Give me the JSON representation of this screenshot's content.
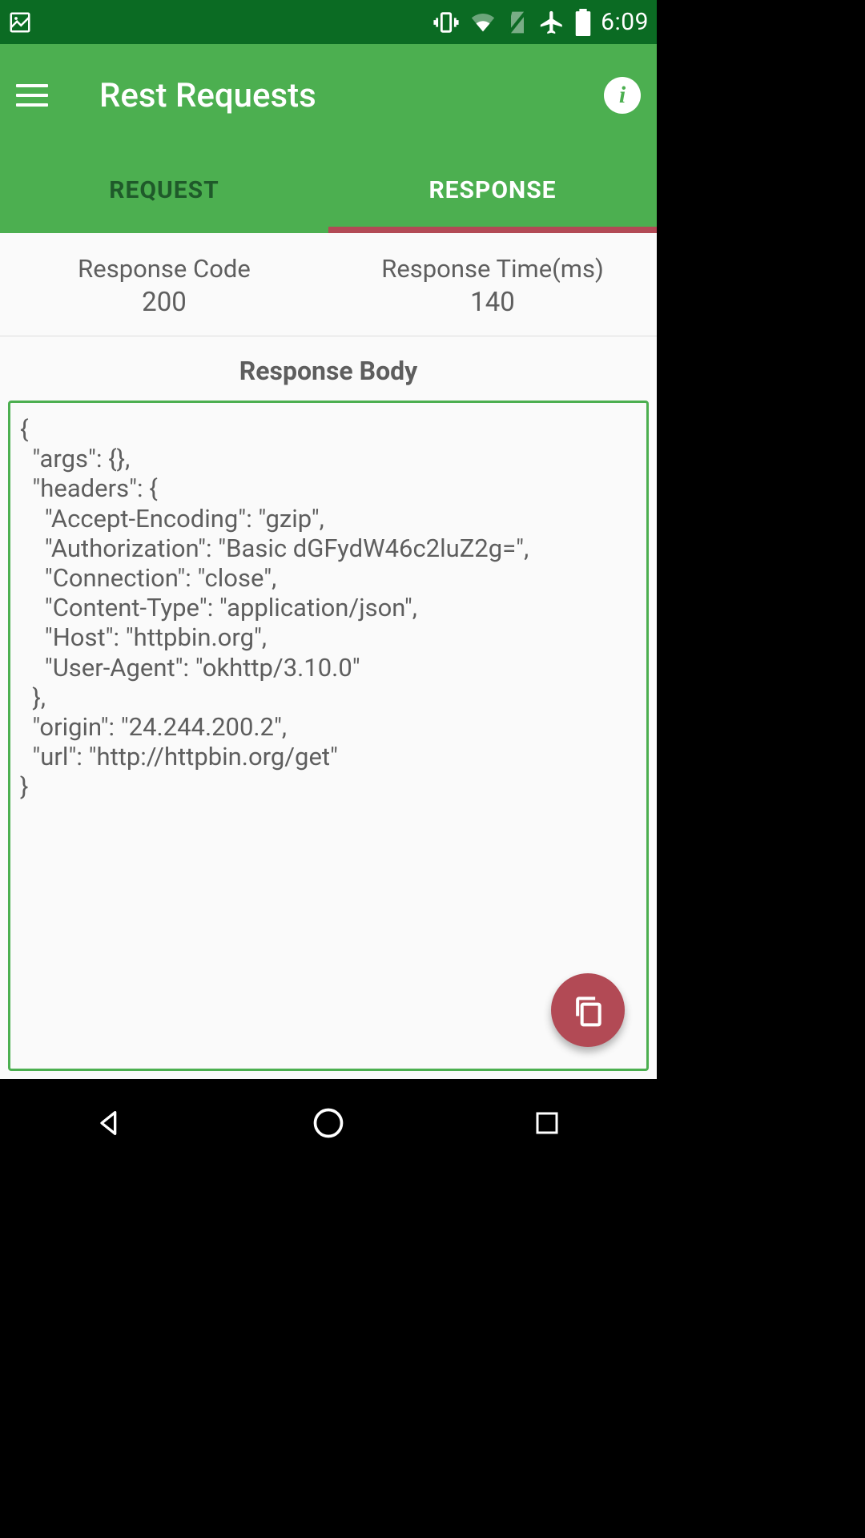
{
  "statusbar": {
    "time": "6:09"
  },
  "appbar": {
    "title": "Rest Requests"
  },
  "tabs": {
    "request": "REQUEST",
    "response": "RESPONSE",
    "active": "response"
  },
  "summary": {
    "code_label": "Response Code",
    "code_value": "200",
    "time_label": "Response Time(ms)",
    "time_value": "140"
  },
  "body": {
    "heading": "Response Body",
    "content": "{\n  \"args\": {}, \n  \"headers\": {\n    \"Accept-Encoding\": \"gzip\", \n    \"Authorization\": \"Basic dGFydW46c2luZ2g=\", \n    \"Connection\": \"close\", \n    \"Content-Type\": \"application/json\", \n    \"Host\": \"httpbin.org\", \n    \"User-Agent\": \"okhttp/3.10.0\"\n  }, \n  \"origin\": \"24.244.200.2\", \n  \"url\": \"http://httpbin.org/get\"\n}"
  }
}
